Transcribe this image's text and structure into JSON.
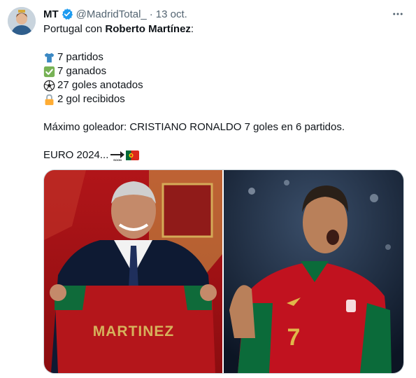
{
  "tweet": {
    "name": "MT",
    "handle": "@MadridTotal_",
    "separator": "·",
    "time": "13 oct.",
    "more_icon": "more-horizontal-icon",
    "text_prefix": "Portugal con ",
    "text_bold": "Roberto Martínez",
    "text_suffix": ":",
    "stats": [
      {
        "icon": "shirt-icon",
        "text": "7 partidos"
      },
      {
        "icon": "check-icon",
        "text": "7 ganados"
      },
      {
        "icon": "soccer-ball-icon",
        "text": "27 goles anotados"
      },
      {
        "icon": "padlock-icon",
        "text": "2 gol recibidos"
      }
    ],
    "top_scorer": "Máximo goleador: CRISTIANO RONALDO 7 goles en 6 partidos.",
    "euro": "EURO 2024..."
  },
  "media": {
    "left_image": "roberto-martinez-holding-jersey",
    "right_image": "cristiano-ronaldo-celebrating",
    "jersey_text": "MARTINEZ"
  },
  "colors": {
    "text": "#0f1419",
    "secondary": "#536471",
    "verified": "#1d9bf0",
    "border": "#cfd9de"
  }
}
